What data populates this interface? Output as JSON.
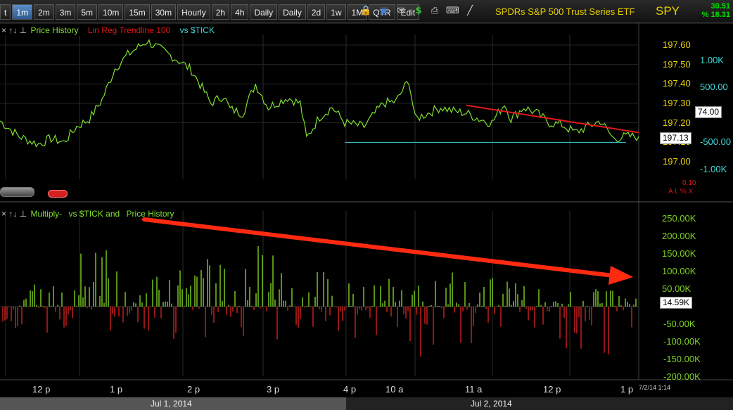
{
  "toolbar": {
    "timeframes": [
      "t",
      "1m",
      "2m",
      "3m",
      "5m",
      "10m",
      "15m",
      "30m",
      "Hourly",
      "2h",
      "4h",
      "Daily",
      "Daily",
      "2d",
      "1w",
      "1M",
      "QTR",
      "Edit"
    ],
    "active_timeframe": "1m",
    "icons": [
      "lock-icon",
      "save-icon",
      "mail-icon",
      "dollar-icon",
      "print-icon",
      "keyboard-icon",
      "draw-icon"
    ],
    "title": "SPDRs S&P 500 Trust Series ETF",
    "symbol": "SPY",
    "change": "30.51",
    "change_pct": "% 18.31"
  },
  "colors": {
    "price": "#7fe030",
    "regression": "#e01818",
    "tick_axis": "#40d8d8",
    "price_axis": "#e8d000",
    "pos_bar": "#7fd020",
    "neg_bar": "#d42020",
    "arrow": "#ff2a10"
  },
  "upper_panel": {
    "controls": "× ↑↓ ⊥",
    "legend": {
      "price": "Price History",
      "regression": "Lin Reg Trendline 100",
      "tick": "vs $TICK"
    },
    "price_ticks": [
      "197.60",
      "197.50",
      "197.40",
      "197.30",
      "197.20",
      "197.10",
      "197.00"
    ],
    "tick_ticks": [
      "1.00K",
      "500.00",
      "-500.00",
      "-1.00K"
    ],
    "last_price": "197.13",
    "last_tick": "74.00",
    "small_value": "0.10",
    "small_flags": "A L % X"
  },
  "lower_panel": {
    "controls": "× ↑↓ ⊥",
    "legend": {
      "multiply": "Multiply-",
      "vs": "vs $TICK and",
      "price": "Price History"
    },
    "y_ticks": [
      "250.00K",
      "200.00K",
      "150.00K",
      "100.00K",
      "50.00K",
      "-50.00K",
      "-100.00K",
      "-150.00K",
      "-200.00K"
    ],
    "last_value": "14.59K"
  },
  "x_axis": {
    "time_labels": [
      "12 p",
      "1 p",
      "2 p",
      "3 p",
      "4 p",
      "10 a",
      "11 a",
      "12 p",
      "1 p"
    ],
    "timestamp": "7/2/14 1:14",
    "dates": [
      "Jul 1, 2014",
      "Jul 2, 2014"
    ]
  },
  "chart_data": [
    {
      "type": "line",
      "title": "SPDRs S&P 500 Trust Series ETF",
      "ylabel": "",
      "ylim": [
        196.97,
        197.67
      ],
      "y2lim": [
        -1200,
        1600
      ],
      "series": [
        {
          "name": "Price History",
          "x": [
            0,
            3,
            6,
            8,
            10,
            12,
            14,
            16,
            18,
            20,
            23,
            26,
            28,
            30,
            32,
            33,
            35,
            36,
            38,
            40,
            42,
            45,
            47,
            48,
            50,
            52,
            54,
            57,
            60,
            62,
            64,
            65,
            67,
            69,
            71,
            73,
            75,
            77,
            79,
            80,
            82,
            84,
            86,
            88,
            90,
            92,
            94,
            96,
            98,
            100
          ],
          "values": [
            197.21,
            197.13,
            197.09,
            197.12,
            197.1,
            197.18,
            197.22,
            197.32,
            197.48,
            197.55,
            197.62,
            197.56,
            197.52,
            197.47,
            197.36,
            197.3,
            197.34,
            197.27,
            197.25,
            197.4,
            197.28,
            197.33,
            197.3,
            197.12,
            197.23,
            197.28,
            197.2,
            197.18,
            197.3,
            197.31,
            197.42,
            197.22,
            197.25,
            197.28,
            197.26,
            197.25,
            197.22,
            197.2,
            197.3,
            197.22,
            197.28,
            197.25,
            197.2,
            197.19,
            197.15,
            197.18,
            197.21,
            197.12,
            197.13,
            197.13
          ]
        },
        {
          "name": "Lin Reg Trendline 100",
          "x": [
            73,
            100
          ],
          "values": [
            197.29,
            197.15
          ]
        }
      ],
      "reference_line": 197.1
    },
    {
      "type": "bar",
      "title": "Multiply- vs $TICK and Price History",
      "ylim": [
        -230000,
        270000
      ],
      "values_k_profile": [
        [
          0,
          60
        ],
        [
          8,
          80
        ],
        [
          12,
          150
        ],
        [
          16,
          220
        ],
        [
          20,
          180
        ],
        [
          23,
          130
        ],
        [
          27,
          100
        ],
        [
          31,
          150
        ],
        [
          36,
          120
        ],
        [
          40,
          180
        ],
        [
          45,
          130
        ],
        [
          50,
          110
        ],
        [
          54,
          80
        ],
        [
          59,
          70
        ],
        [
          64,
          110
        ],
        [
          68,
          90
        ],
        [
          72,
          120
        ],
        [
          78,
          80
        ],
        [
          84,
          60
        ],
        [
          90,
          60
        ],
        [
          95,
          50
        ],
        [
          100,
          50
        ]
      ],
      "neg_profile": [
        [
          0,
          -60
        ],
        [
          10,
          -90
        ],
        [
          17,
          -80
        ],
        [
          26,
          -80
        ],
        [
          30,
          -150
        ],
        [
          38,
          -90
        ],
        [
          44,
          -120
        ],
        [
          50,
          -70
        ],
        [
          56,
          -90
        ],
        [
          62,
          -100
        ],
        [
          66,
          -180
        ],
        [
          74,
          -110
        ],
        [
          80,
          -90
        ],
        [
          87,
          -120
        ],
        [
          93,
          -180
        ],
        [
          97,
          -110
        ],
        [
          100,
          -40
        ]
      ],
      "last_value": 14590
    }
  ]
}
